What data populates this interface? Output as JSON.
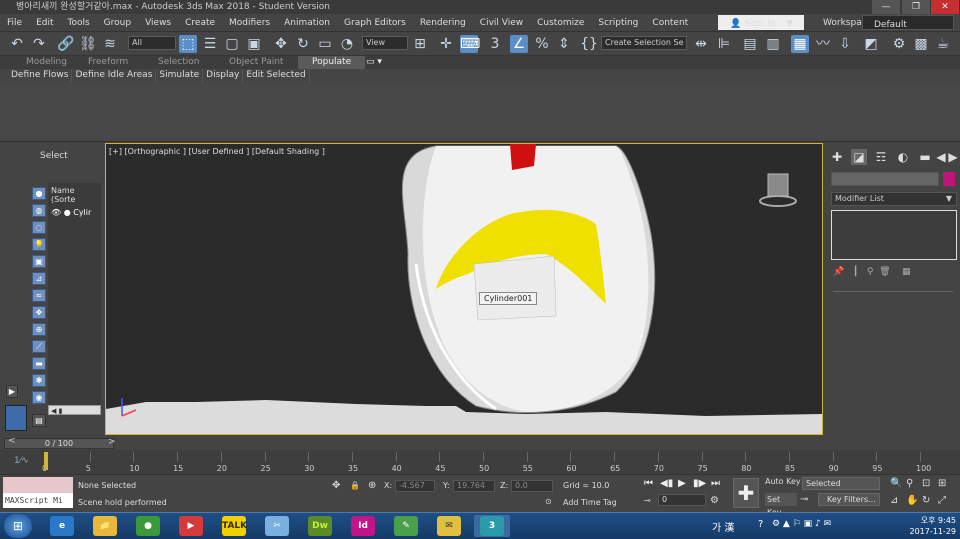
{
  "window": {
    "title": "병아리새끼 완성할거같아.max - Autodesk 3ds Max 2018 - Student Version",
    "controls": [
      "—",
      "❐",
      "✕"
    ]
  },
  "menu": {
    "items": [
      "File",
      "Edit",
      "Tools",
      "Group",
      "Views",
      "Create",
      "Modifiers",
      "Animation",
      "Graph Editors",
      "Rendering",
      "Civil View",
      "Customize",
      "Scripting",
      "Content"
    ],
    "sign_in": "Sign In",
    "workspaces_label": "Workspaces:",
    "workspace_value": "Default"
  },
  "toolbar": {
    "selection_filter": "All",
    "reference_coord": "View",
    "named_selection": "Create Selection Se"
  },
  "ribbon": {
    "tabs": [
      "Modeling",
      "Freeform",
      "Selection",
      "Object Paint",
      "Populate"
    ],
    "active_tab": "Populate",
    "subtabs": [
      "Define Flows",
      "Define Idle Areas",
      "Simulate",
      "Display",
      "Edit Selected"
    ]
  },
  "scene_explorer": {
    "title": "Select",
    "column_header": "Name (Sorte",
    "rows": [
      {
        "name": "Cylir"
      }
    ]
  },
  "viewport": {
    "label": "[+] [Orthographic ] [User Defined ] [Default Shading ]",
    "tooltip": "Cylinder001"
  },
  "command_panel": {
    "modifier_list": "Modifier List",
    "object_color": "#c0147a"
  },
  "timeline": {
    "frame_display": "0 / 100",
    "ticks": [
      "0",
      "5",
      "10",
      "15",
      "20",
      "25",
      "30",
      "35",
      "40",
      "45",
      "50",
      "55",
      "60",
      "65",
      "70",
      "75",
      "80",
      "85",
      "90",
      "95",
      "100"
    ]
  },
  "status": {
    "maxscript": "MAXScript Mi",
    "selection": "None Selected",
    "prompt": "Scene hold performed",
    "x_label": "X:",
    "x_value": "-4.567",
    "y_label": "Y:",
    "y_value": "19.764",
    "z_label": "Z:",
    "z_value": "0.0",
    "grid": "Grid = 10.0",
    "add_time_tag": "Add Time Tag",
    "current_frame": "0",
    "auto_key": "Auto Key",
    "selected_set": "Selected",
    "set_key": "Set Key",
    "key_filters": "Key Filters..."
  },
  "taskbar": {
    "ime": "가 漢",
    "time": "오후 9:45",
    "date": "2017-11-29",
    "apps": [
      "e",
      "📁",
      "●",
      "▶",
      "TALK",
      "✂",
      "Dw",
      "Id",
      "✎",
      "✉",
      "3"
    ]
  }
}
